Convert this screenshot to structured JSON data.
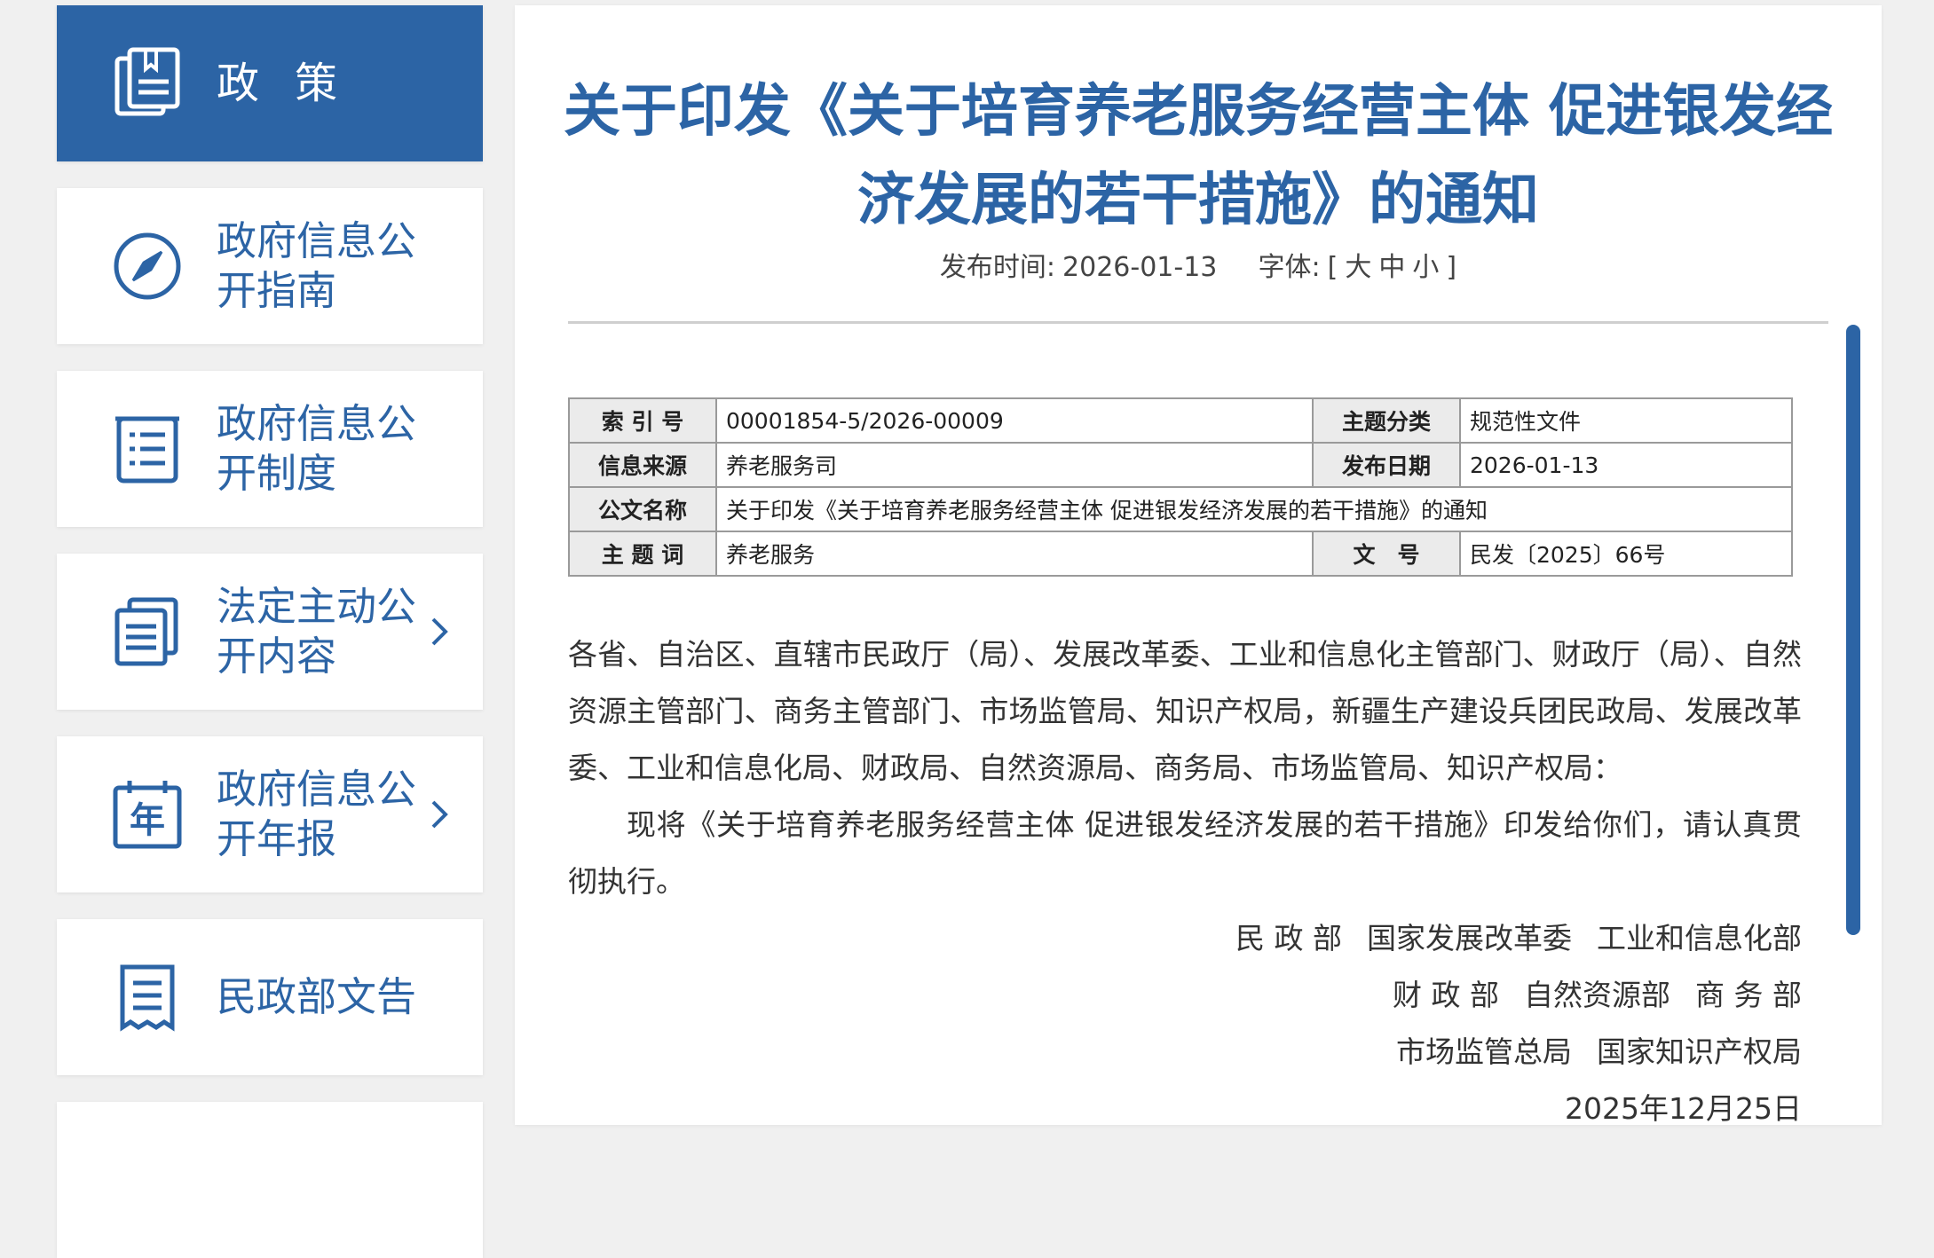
{
  "sidebar": {
    "items": [
      {
        "label": "政策",
        "active": true
      },
      {
        "label": "政府信息公开指南"
      },
      {
        "label": "政府信息公开制度"
      },
      {
        "label": "法定主动公开内容",
        "chevron": true
      },
      {
        "label": "政府信息公开年报",
        "chevron": true
      },
      {
        "label": "民政部文告"
      }
    ]
  },
  "doc": {
    "title": "关于印发《关于培育养老服务经营主体 促进银发经济发展的若干措施》的通知",
    "publish_label": "发布时间:",
    "publish_date": "2026-01-13",
    "font_label": "字体:",
    "font_open": "[",
    "font_large": "大",
    "font_medium": "中",
    "font_small": "小",
    "font_close": "]"
  },
  "meta": {
    "index_label": "索 引 号",
    "index_value": "00001854-5/2026-00009",
    "topic_label": "主题分类",
    "topic_value": "规范性文件",
    "source_label": "信息来源",
    "source_value": "养老服务司",
    "date_label": "发布日期",
    "date_value": "2026-01-13",
    "name_label": "公文名称",
    "name_value": "关于印发《关于培育养老服务经营主体 促进银发经济发展的若干措施》的通知",
    "keyword_label": "主 题 词",
    "keyword_value": "养老服务",
    "docno_label": "文　号",
    "docno_value": "民发〔2025〕66号"
  },
  "body": {
    "addressees": "各省、自治区、直辖市民政厅（局）、发展改革委、工业和信息化主管部门、财政厅（局）、自然资源主管部门、商务主管部门、市场监管局、知识产权局，新疆生产建设兵团民政局、发展改革委、工业和信息化局、财政局、自然资源局、商务局、市场监管局、知识产权局：",
    "paragraph1": "现将《关于培育养老服务经营主体 促进银发经济发展的若干措施》印发给你们，请认真贯彻执行。",
    "signers_row1": [
      "民 政 部",
      "国家发展改革委",
      "工业和信息化部"
    ],
    "signers_row2": [
      "财 政 部",
      "自然资源部",
      "商 务 部"
    ],
    "signers_row3": [
      "市场监管总局",
      "国家知识产权局"
    ],
    "sign_date": "2025年12月25日"
  },
  "colors": {
    "accent": "#2c64a5",
    "background": "#f0f0f0"
  },
  "icons": [
    "document-stack-icon",
    "compass-icon",
    "list-icon",
    "documents-icon",
    "calendar-year-icon",
    "notice-icon",
    "chevron-right-icon"
  ]
}
